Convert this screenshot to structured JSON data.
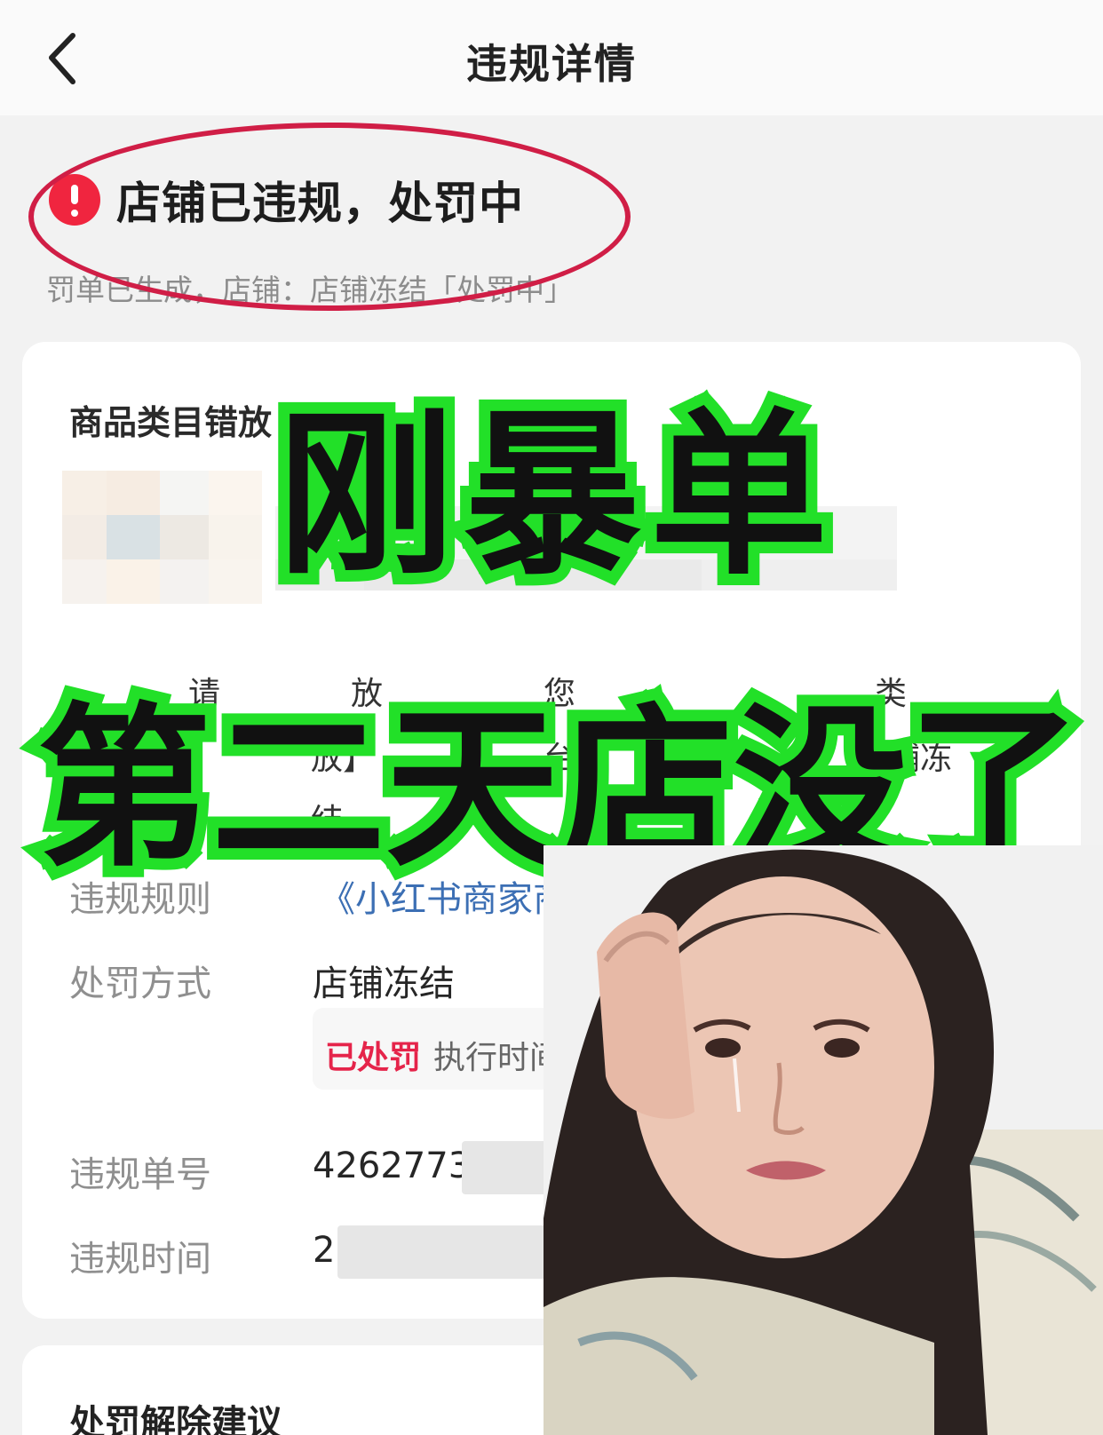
{
  "nav": {
    "title": "违规详情",
    "back_icon": "chevron-left-icon"
  },
  "status": {
    "title": "店铺已违规，处罚中",
    "subtitle": "罚单已生成，店铺：店铺冻结「处罚中」",
    "icon": "exclamation-circle-icon",
    "icon_color": "#f0253f",
    "circle_color": "#d01e46"
  },
  "card": {
    "heading": "商品类目错放",
    "desc_fragments": [
      "请",
      "放",
      "您",
      "类",
      "放】",
      "台",
      "铺冻",
      "结。"
    ],
    "fields": [
      {
        "label": "违规规则",
        "value": "《小红书商家商品发"
      },
      {
        "label": "处罚方式",
        "value": "店铺冻结"
      },
      {
        "label": "违规单号",
        "value": "4262773"
      },
      {
        "label": "违规时间",
        "value": "2"
      }
    ],
    "penalty_status": {
      "chip": "已处罚",
      "exec_label": "执行时间"
    }
  },
  "bottom_card": {
    "heading": "处罚解除建议"
  },
  "overlay": {
    "line1": "刚暴单",
    "line2": "第二天店没了",
    "stroke_color": "#22e028"
  },
  "accent": {
    "link": "#3c6fb4",
    "danger": "#e5244a"
  }
}
